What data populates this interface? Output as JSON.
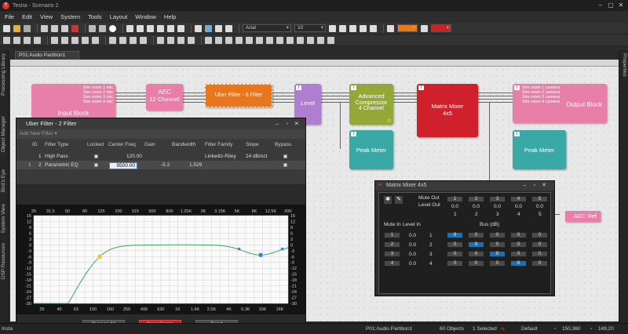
{
  "window": {
    "title": "Tesira - Scenario 2",
    "icon_letter": "T"
  },
  "menu": [
    "File",
    "Edit",
    "View",
    "System",
    "Tools",
    "Layout",
    "Window",
    "Help"
  ],
  "toolbar": {
    "font_name": "Arial",
    "font_size": "10",
    "zoom_dropdown": ""
  },
  "side_tabs_left": [
    "Processing Library",
    "Object Manager",
    "Bird's Eye",
    "System View",
    "DSP Resources"
  ],
  "side_tabs_right": [
    "Properties"
  ],
  "document_tab": "P01:Audio Partition1",
  "blocks": {
    "input": {
      "title": "Input Block",
      "channels": [
        "Sim room 1 mic",
        "Sim room 2 mic",
        "Sim room 3 mic",
        "Sim room 4 mic"
      ]
    },
    "aec": {
      "line1": "AEC",
      "line2": "12 Channel"
    },
    "uber": {
      "label": "Uber Filter - 6 Filter"
    },
    "level": {
      "label": "Level"
    },
    "compressor": {
      "line1": "Advanced",
      "line2": "Compressor",
      "line3": "4 Channel",
      "badge": "G"
    },
    "peak1": {
      "label": "Peak Meter"
    },
    "matrix": {
      "line1": "Matrix Mixer",
      "line2": "4x5"
    },
    "output": {
      "title": "Output Block",
      "channels": [
        "Sim room 1 camera",
        "Sim room 2 camera",
        "Sim room 3 camera",
        "Sim room 4 camera"
      ]
    },
    "peak2": {
      "label": "Peak Meter"
    },
    "aecref": {
      "label": "AEC Ref"
    }
  },
  "uber_window": {
    "title": "Uber Filter - 2 Filter",
    "add_filter": "Add New Filter",
    "columns": [
      "ID",
      "Filter Type",
      "Locked",
      "Center Freq",
      "Gain",
      "Bandwidth",
      "Filter Family",
      "Slope",
      "Bypass"
    ],
    "rows": [
      {
        "id": "1",
        "type": "High Pass",
        "center": "120.00",
        "gain": "",
        "bandwidth": "",
        "family": "Linkwitz-Riley",
        "slope": "24 dB/oct"
      },
      {
        "id": "2",
        "type": "Parametric EQ",
        "center": "9500.00",
        "gain": "-5.2",
        "bandwidth": "1.529",
        "family": "",
        "slope": ""
      }
    ],
    "top_freq_labels": [
      "20",
      "31.5",
      "50",
      "80",
      "125",
      "200",
      "315",
      "500",
      "800",
      "1.25K",
      "2K",
      "3.15K",
      "5K",
      "8K",
      "12.5K",
      "20K"
    ],
    "bottom_freq_labels": [
      "25",
      "40",
      "63",
      "100",
      "160",
      "250",
      "400",
      "630",
      "1K",
      "1.6K",
      "2.5K",
      "4K",
      "6.3K",
      "10K",
      "16K"
    ],
    "db_labels": [
      "15",
      "12",
      "9",
      "6",
      "3",
      "0",
      "-3",
      "-6",
      "-9",
      "-12",
      "-15",
      "-18",
      "-21",
      "-24",
      "-27",
      "-30"
    ],
    "buttons": [
      "Bypass All",
      "Drag Points",
      "Band"
    ]
  },
  "matrix_window": {
    "title": "Matrix Mixer 4x5",
    "mute_out": "Mute Out",
    "level_out": "Level Out",
    "mute_in": "Mute In",
    "level_in": "Level In",
    "bus_label": "Bus (dB)",
    "out_mutes": [
      "1",
      "2",
      "3",
      "4",
      "5"
    ],
    "out_levels": [
      "0.0",
      "0.0",
      "0.0",
      "0.0",
      "0.0"
    ],
    "out_nums": [
      "1",
      "2",
      "3",
      "4",
      "5"
    ],
    "inputs": [
      {
        "mute": "1",
        "level": "0.0",
        "num": "1",
        "cells": [
          "0",
          "0",
          "0",
          "0",
          "0"
        ]
      },
      {
        "mute": "2",
        "level": "0.0",
        "num": "2",
        "cells": [
          "0",
          "0",
          "0",
          "0",
          "0"
        ]
      },
      {
        "mute": "3",
        "level": "0.0",
        "num": "3",
        "cells": [
          "0",
          "0",
          "0",
          "0",
          "0"
        ]
      },
      {
        "mute": "4",
        "level": "0.0",
        "num": "4",
        "cells": [
          "0",
          "0",
          "0",
          "0",
          "0"
        ]
      }
    ]
  },
  "status": {
    "left": "Insta",
    "partition": "P01:Audio Partition1",
    "objects": "60 Objects",
    "selected": "1 Selected",
    "style": "Default",
    "coords": "150,360",
    "size": "149,20"
  }
}
